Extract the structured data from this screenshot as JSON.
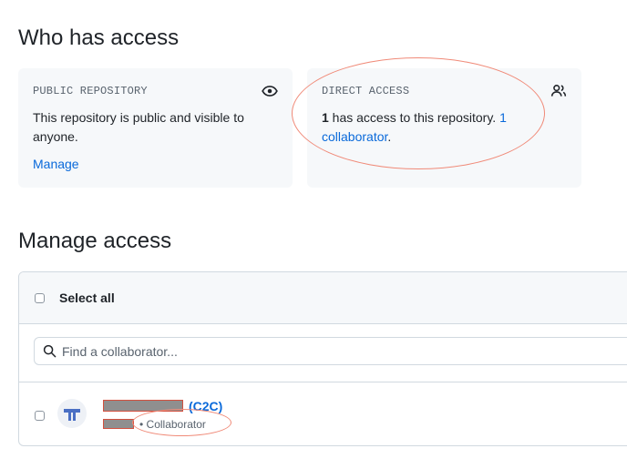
{
  "who_has_access": {
    "title": "Who has access",
    "public_card": {
      "label": "PUBLIC REPOSITORY",
      "icon": "eye-icon",
      "text": "This repository is public and visible to anyone.",
      "manage_link": "Manage"
    },
    "direct_card": {
      "label": "DIRECT ACCESS",
      "icon": "people-icon",
      "count": "1",
      "text_middle": " has access to this repository. ",
      "collaborator_link": "1 collaborator",
      "text_end": "."
    }
  },
  "manage_access": {
    "title": "Manage access",
    "select_all_label": "Select all",
    "search": {
      "placeholder": "Find a collaborator..."
    },
    "members": [
      {
        "name_suffix": "(C2C)",
        "role": "• Collaborator"
      }
    ]
  },
  "colors": {
    "link": "#0969da",
    "annotation": "#f08a78",
    "card_bg": "#f6f8fa"
  }
}
